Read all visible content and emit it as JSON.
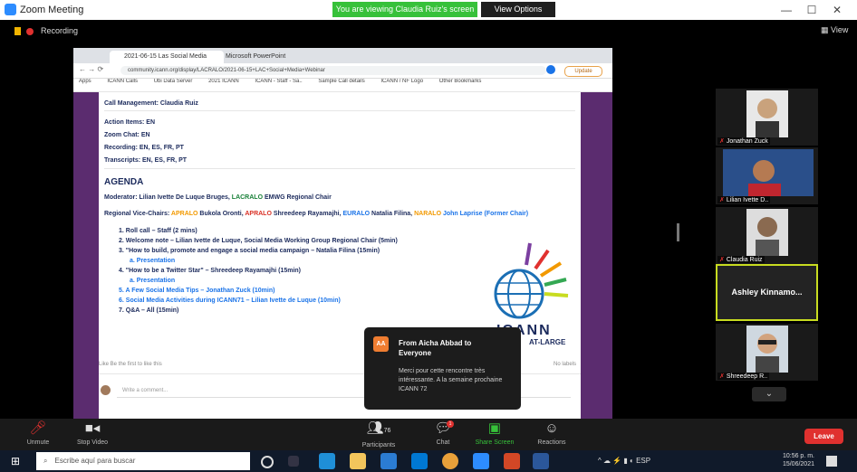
{
  "window": {
    "title": "Zoom Meeting",
    "recording_banner": "You are viewing Claudia Ruiz's screen",
    "view_options": "View Options",
    "controls": {
      "minimize": "—",
      "maximize": "☐",
      "close": "✕"
    }
  },
  "meeting_bar": {
    "recording": "Recording",
    "view": "View"
  },
  "browser": {
    "tabs": [
      "2021-06-15 Las Social Media Camp..",
      "Microsoft PowerPoint"
    ],
    "url": "community.icann.org/display/LACRALO/2021-06-15+LAC+Social+Media+Webinar",
    "update_label": "Update",
    "bookmarks": [
      "Apps",
      "ICANN Calls",
      "Ubi Data Server",
      "2021 ICANN",
      "ICANN - Staff - Sa..",
      "Sample Call details",
      "ICANN / NF Logo",
      "Other Bookmarks"
    ]
  },
  "doc": {
    "call_management": "Call Management: Claudia Ruiz",
    "action_items": "Action Items: EN",
    "zoom_chat": "Zoom Chat: EN",
    "recording": "Recording: EN, ES, FR, PT",
    "transcripts": "Transcripts: EN, ES, FR, PT",
    "agenda_heading": "AGENDA",
    "moderator_prefix": "Moderator: Lilian Ivette De Luque Bruges, ",
    "moderator_org": "LACRALO",
    "moderator_suffix": " EMWG Regional Chair",
    "vice_prefix": "Regional Vice-Chairs: ",
    "vice_1_org": "APRALO",
    "vice_1_name": " Bukola Oronti, ",
    "vice_2_org": "APRALO",
    "vice_2_name": " Shreedeep Rayamajhi, ",
    "vice_3_org": "EURALO",
    "vice_3_name": " Natalia Filina, ",
    "vice_4_org": "NARALO",
    "vice_4_name": " John Laprise (Former Chair)",
    "items": [
      "1. Roll call – Staff (2 mins)",
      "2. Welcome note – Lilian Ivette de Luque, Social Media Working Group Regional Chair (5min)",
      "3. \"How to build, promote and engage a social media campaign – Natalia Filina (15min)",
      "4. \"How to be a Twitter Star\" – Shreedeep Rayamajhi (15min)",
      "5. A Few Social Media Tips – Jonathan Zuck (10min)",
      "6. Social Media Activities during ICANN71 – Lilian Ivette de Luque (10min)",
      "7. Q&A – All (15min)"
    ],
    "sub_items": [
      "a. Presentation",
      "a. Presentation"
    ],
    "logo_text": "ICANN",
    "logo_sub": "AT-LARGE",
    "likes": "Like   Be the first to like this",
    "views": "No labels",
    "comment_placeholder": "Write a comment..."
  },
  "chat_popup": {
    "avatar": "AA",
    "from": "From Aicha Abbad to Everyone",
    "message": "Merci pour cette rencontre très intéressante. A la semaine prochaine ICANN 72"
  },
  "participants": [
    {
      "name": "Jonathan Zuck"
    },
    {
      "name": "Lilian Ivette D.."
    },
    {
      "name": "Claudia Ruiz"
    },
    {
      "name": "Ashley Kinnamo..."
    },
    {
      "name": "Shreedeep R.."
    }
  ],
  "toolbar": {
    "unmute": "Unmute",
    "stop_video": "Stop Video",
    "participants": "Participants",
    "participants_count": "76",
    "chat": "Chat",
    "chat_badge": "1",
    "share_screen": "Share Screen",
    "reactions": "Reactions",
    "leave": "Leave"
  },
  "taskbar": {
    "search_placeholder": "Escribe aquí para buscar",
    "tray": "^  ☁  ⚡  ▮  ◐  ESP",
    "time": "10:56 p. m.",
    "date": "15/06/2021"
  },
  "colors": {
    "purple_border": "#5b2c6f",
    "rec_green": "#37c13a",
    "leave_red": "#e0312f",
    "active_speaker": "#c8dc20"
  }
}
